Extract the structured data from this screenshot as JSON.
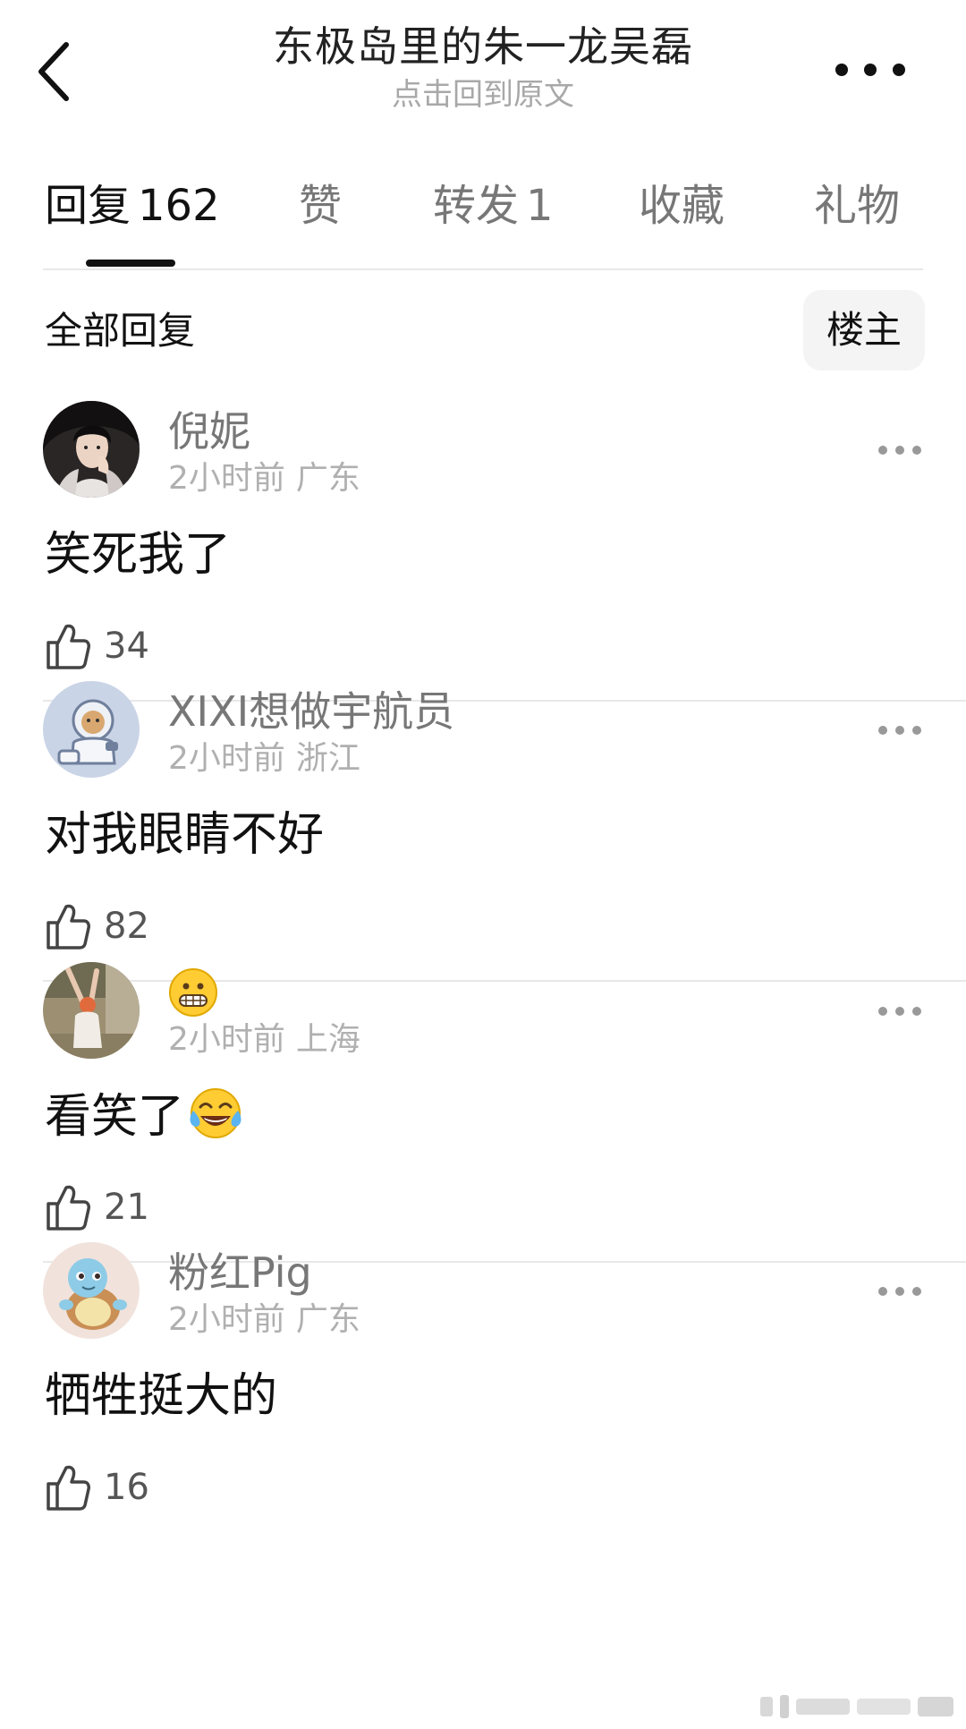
{
  "header": {
    "title": "东极岛里的朱一龙吴磊",
    "subtitle": "点击回到原文"
  },
  "tabs": [
    {
      "label": "回复",
      "count": "162",
      "active": true
    },
    {
      "label": "赞",
      "count": "",
      "active": false
    },
    {
      "label": "转发",
      "count": "1",
      "active": false
    },
    {
      "label": "收藏",
      "count": "",
      "active": false
    },
    {
      "label": "礼物",
      "count": "",
      "active": false
    }
  ],
  "filter": {
    "label": "全部回复",
    "op_button": "楼主"
  },
  "comments": [
    {
      "username": "倪妮",
      "time": "2小时前",
      "location": "广东",
      "content": "笑死我了",
      "likes": "34",
      "avatar": "woman-portrait-avatar"
    },
    {
      "username": "XIXI想做宇航员",
      "time": "2小时前",
      "location": "浙江",
      "content": "对我眼睛不好",
      "likes": "82",
      "avatar": "astronaut-avatar"
    },
    {
      "username": "",
      "username_emoji": "grimacing-face",
      "time": "2小时前",
      "location": "上海",
      "content": "看笑了",
      "content_emoji": "face-with-tears-of-joy",
      "likes": "21",
      "avatar": "dancing-woman-avatar"
    },
    {
      "username": "粉红Pig",
      "time": "2小时前",
      "location": "广东",
      "content": "牺牲挺大的",
      "likes": "16",
      "avatar": "squirtle-avatar"
    }
  ],
  "colors": {
    "text_primary": "#111111",
    "text_secondary": "#777777",
    "text_meta": "#b0b0b0",
    "divider": "#e8e8e8",
    "chip_bg": "#f4f4f4"
  }
}
